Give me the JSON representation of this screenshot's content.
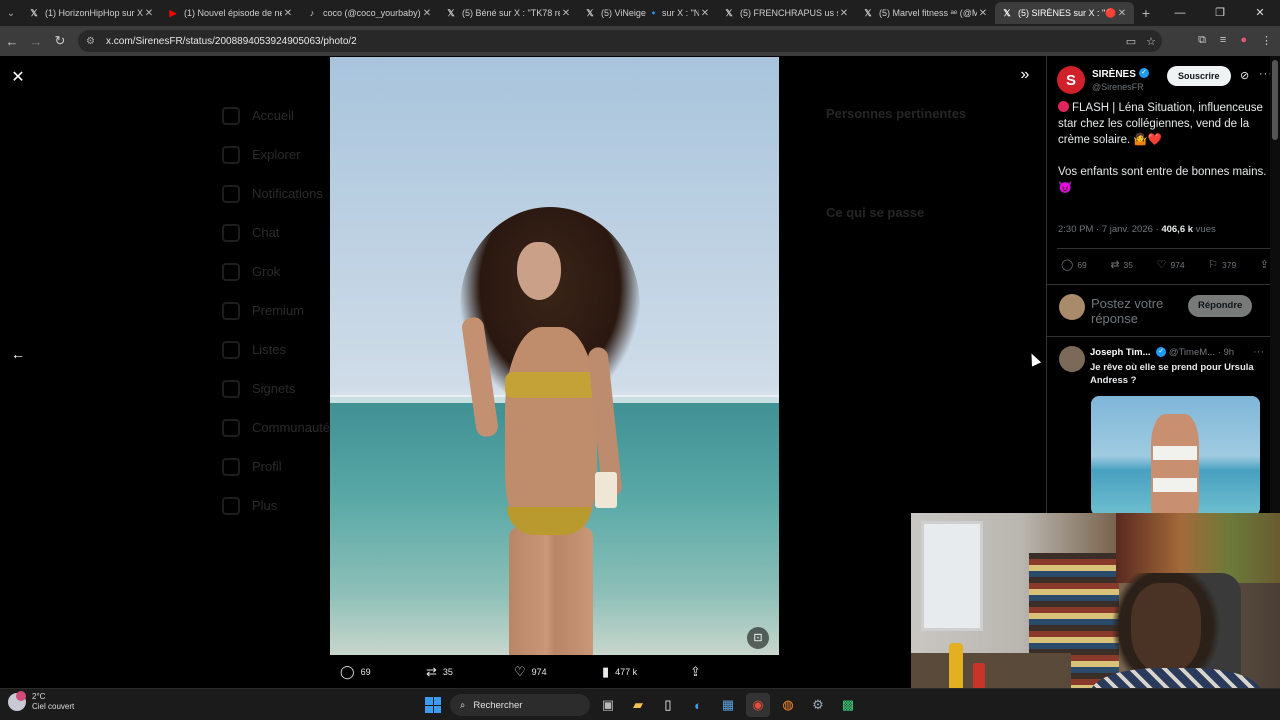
{
  "browser": {
    "tabs": [
      {
        "title": "(1) HorizonHipHop sur X",
        "favicon": "X",
        "active": false
      },
      {
        "title": "(1) Nouvel épisode de ne",
        "favicon": "▶",
        "active": false
      },
      {
        "title": "coco (@coco_yourbaby) |",
        "favicon": "♪",
        "active": false
      },
      {
        "title": "(5) Béné sur X : \"TK78 réa",
        "favicon": "X",
        "active": false
      },
      {
        "title": "(5) ViNeige 🔹 sur X : \"Na",
        "favicon": "X",
        "active": false
      },
      {
        "title": "(5) FRENCHRAPUS us sur",
        "favicon": "X",
        "active": false
      },
      {
        "title": "(5) Marvel fitness ᵃᵉ (@M",
        "favicon": "X",
        "active": false
      },
      {
        "title": "(5) SIRÈNES sur X : \"🔴 FL",
        "favicon": "X",
        "active": true
      }
    ],
    "url": "x.com/SirenesFR/status/2008894053924905063/photo/2"
  },
  "background_nav": [
    "Accueil",
    "Explorer",
    "Notifications",
    "Chat",
    "Grok",
    "Premium",
    "Listes",
    "Signets",
    "Communautés",
    "Profil",
    "Plus"
  ],
  "background_right": {
    "heading": "Personnes pertinentes",
    "heading2": "Ce qui se passe"
  },
  "photo_actions": {
    "replies": "69",
    "reposts": "35",
    "likes": "974",
    "views": "477 k"
  },
  "tweet": {
    "author_name": "SIRÈNES",
    "author_handle": "@SirenesFR",
    "avatar_letter": "S",
    "subscribe_label": "Souscrire",
    "line1": "FLASH | Léna Situation, influenceuse star chez les collégiennes, vend de la crème solaire. 🤷❤️",
    "line2": "Vos enfants sont entre de bonnes mains. 😈",
    "time": "2:30 PM · 7 janv. 2026 · ",
    "views_count": "406,6 k",
    "views_label": " vues",
    "stats": {
      "replies": "69",
      "reposts": "35",
      "likes": "974",
      "bookmarks": "379"
    },
    "reply_placeholder": "Postez votre réponse",
    "reply_button": "Répondre"
  },
  "comment": {
    "name": "Joseph Tim...",
    "handle": "@TimeM... · 9h",
    "text": "Je rêve où elle se prend pour Ursula Andress ?"
  },
  "taskbar": {
    "temp": "2°C",
    "weather": "Ciel couvert",
    "search_label": "Rechercher"
  },
  "colors": {
    "accent": "#1d9bf0",
    "flash_red": "#e0245e",
    "brand": "#d0212a"
  }
}
